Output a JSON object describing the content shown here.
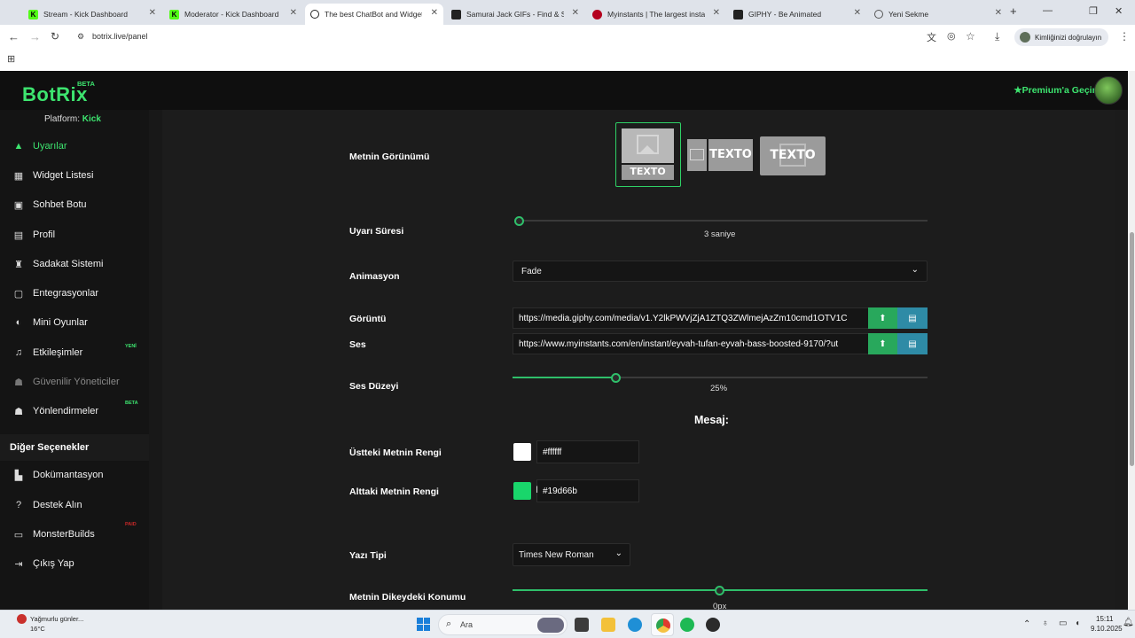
{
  "browser": {
    "tabs": [
      {
        "label": "Stream - Kick Dashboard",
        "active": false,
        "fav": "K"
      },
      {
        "label": "Moderator - Kick Dashboard",
        "active": false,
        "fav": "K"
      },
      {
        "label": "The best ChatBot and Widgets",
        "active": true,
        "fav": "◎"
      },
      {
        "label": "Samurai Jack GIFs - Find & Sh",
        "active": false,
        "fav": "▚"
      },
      {
        "label": "Myinstants | The largest instant",
        "active": false,
        "fav": "●"
      },
      {
        "label": "GIPHY - Be Animated",
        "active": false,
        "fav": "▚"
      },
      {
        "label": "Yeni Sekme",
        "active": false,
        "fav": "◉"
      }
    ],
    "new_tab_label": "+",
    "url": "botrix.live/panel",
    "profile_label": "Kimliğinizi doğrulayın"
  },
  "header": {
    "logo": "BotRix",
    "logo_badge": "BETA",
    "premium_label": "Premium'a Geçin"
  },
  "sidebar": {
    "platform_label": "Platform:",
    "platform_value": "Kick",
    "items": [
      {
        "label": "Uyarılar",
        "icon": "warning-icon",
        "active": true
      },
      {
        "label": "Widget Listesi",
        "icon": "grid-icon"
      },
      {
        "label": "Sohbet Botu",
        "icon": "robot-icon"
      },
      {
        "label": "Profil",
        "icon": "id-card-icon"
      },
      {
        "label": "Sadakat Sistemi",
        "icon": "trophy-icon"
      },
      {
        "label": "Entegrasyonlar",
        "icon": "plug-icon"
      },
      {
        "label": "Mini Oyunlar",
        "icon": "gamepad-icon"
      },
      {
        "label": "Etkileşimler",
        "icon": "music-icon",
        "badge": "YENİ"
      },
      {
        "label": "Güvenilir Yöneticiler",
        "icon": "users-icon",
        "disabled": true
      },
      {
        "label": "Yönlendirmeler",
        "icon": "user-group-icon",
        "badge": "BETA"
      }
    ],
    "other_header": "Diğer Seçenekler",
    "other_items": [
      {
        "label": "Dokümantasyon",
        "icon": "docs-icon"
      },
      {
        "label": "Destek Alın",
        "icon": "question-icon"
      },
      {
        "label": "MonsterBuilds",
        "icon": "laptop-icon",
        "badge": "PAID"
      },
      {
        "label": "Çıkış Yap",
        "icon": "logout-icon"
      }
    ]
  },
  "form": {
    "text_view_label": "Metnin Görünümü",
    "text_view_option_text": "TEXTO",
    "duration_label": "Uyarı Süresi",
    "duration_value": "3 saniye",
    "animation_label": "Animasyon",
    "animation_value": "Fade",
    "image_label": "Görüntü",
    "image_url": "https://media.giphy.com/media/v1.Y2lkPWVjZjA1ZTQ3ZWlmejAzZm10cmd1OTV1C",
    "sound_label": "Ses",
    "sound_url": "https://www.myinstants.com/en/instant/eyvah-tufan-eyvah-bass-boosted-9170/?ut",
    "volume_label": "Ses Düzeyi",
    "volume_value": "25%",
    "volume_fraction": 0.25,
    "message_header": "Mesaj:",
    "top_color_label": "Üstteki Metnin Rengi",
    "top_color_value": "#ffffff",
    "bottom_color_label": "Alttaki Metnin Rengi",
    "bottom_color_value": "#19d66b",
    "font_label": "Yazı Tipi",
    "font_value": "Times New Roman",
    "vertical_pos_label": "Metnin Dikeydeki Konumu",
    "vertical_pos_value": "0px",
    "vertical_pos_fraction": 0.5
  },
  "taskbar": {
    "weather_title": "Yağmurlu günler...",
    "weather_temp": "16°C",
    "search_label": "Ara",
    "time": "15:11",
    "date": "9.10.2025"
  },
  "colors": {
    "accent": "#3de46f",
    "top_swatch": "#ffffff",
    "bottom_swatch": "#19d66b"
  }
}
